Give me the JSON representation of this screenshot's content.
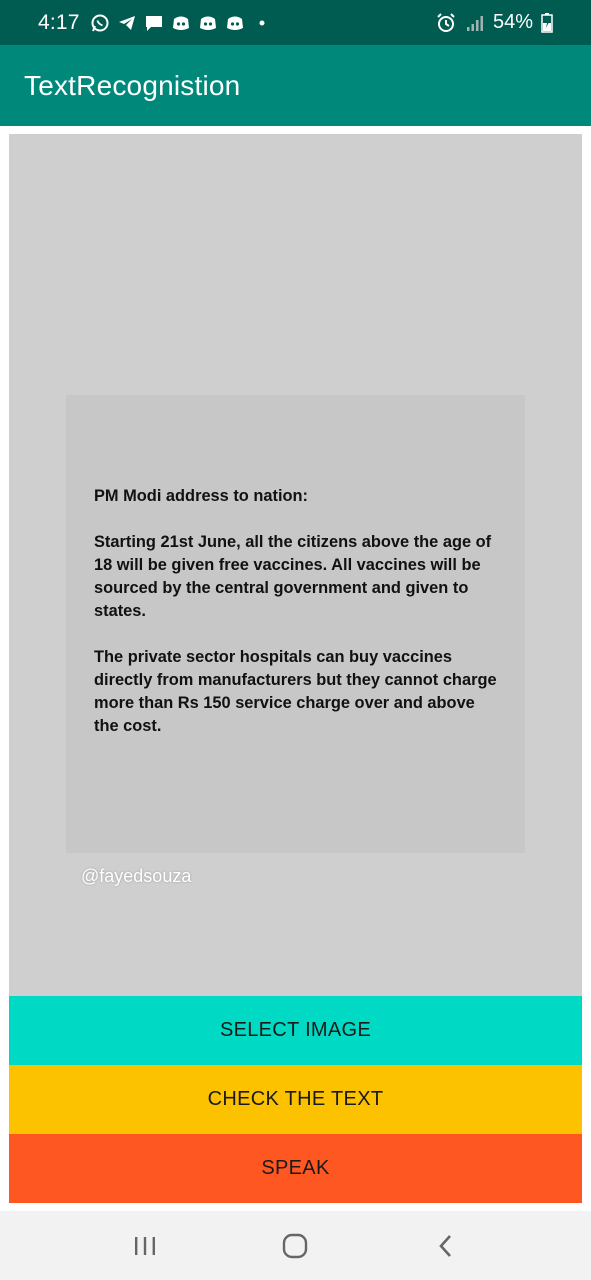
{
  "status_bar": {
    "time": "4:17",
    "battery": "54%",
    "notification_icons": [
      "whatsapp-icon",
      "telegram-icon",
      "message-icon",
      "discord-icon",
      "discord-icon",
      "discord-icon",
      "dot-icon"
    ],
    "right_icons": [
      "alarm-icon",
      "signal-icon",
      "battery-icon"
    ]
  },
  "app_bar": {
    "title": "TextRecognistion"
  },
  "image": {
    "heading": "PM Modi address to nation:",
    "paragraph1": "Starting 21st June, all the citizens above the age of 18 will be given free vaccines. All vaccines will be sourced by the central government and given to states.",
    "paragraph2": "The private sector hospitals can buy vaccines directly from manufacturers but they cannot charge more than Rs 150 service charge over and above the cost.",
    "watermark": "@fayedsouza"
  },
  "buttons": {
    "select_image": "SELECT IMAGE",
    "check_text": "CHECK THE TEXT",
    "speak": "SPEAK"
  },
  "colors": {
    "status_bar": "#005c50",
    "app_bar": "#00897b",
    "select_button": "#00d9c3",
    "check_button": "#fcc200",
    "speak_button": "#ff5722"
  },
  "nav_bar": {
    "icons": [
      "recent-apps-icon",
      "home-icon",
      "back-icon"
    ]
  }
}
